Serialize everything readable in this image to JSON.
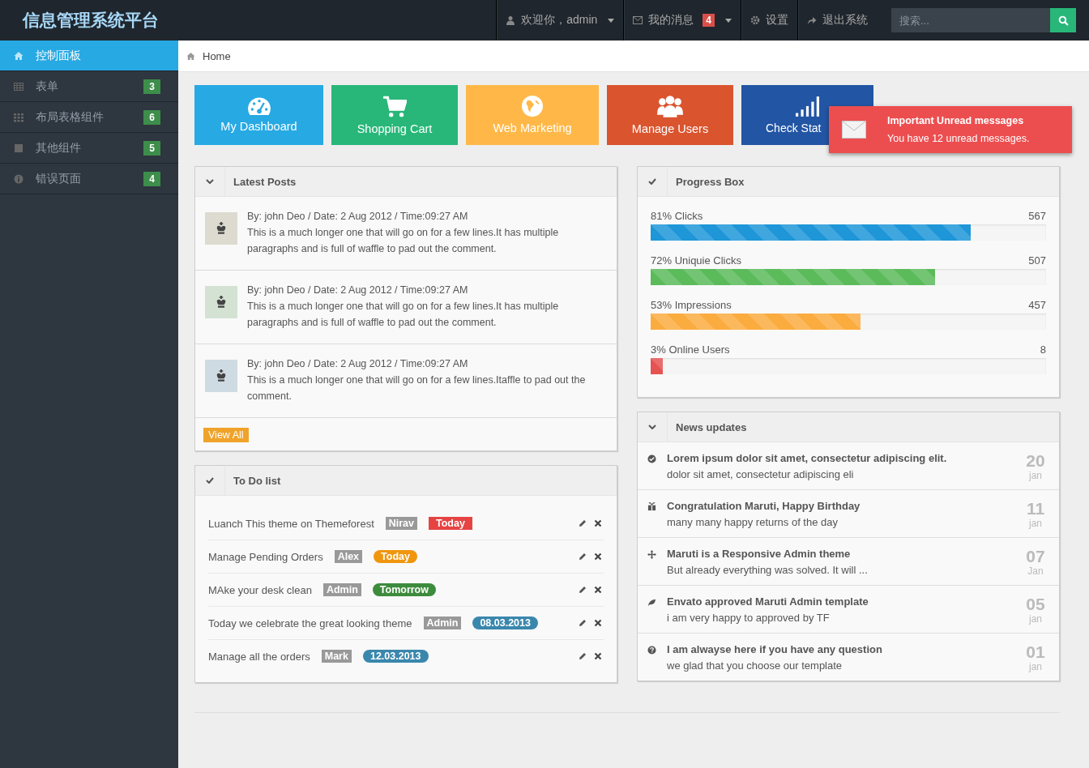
{
  "header": {
    "title": "信息管理系统平台",
    "user_menu": "欢迎你，admin",
    "messages": "我的消息",
    "messages_count": "4",
    "settings": "设置",
    "logout": "退出系统",
    "search": {
      "placeholder": "搜索..."
    }
  },
  "sidebar": {
    "items": [
      {
        "label": "控制面板",
        "kind": "home",
        "selected": true
      },
      {
        "label": "表单",
        "kind": "table",
        "badge": "3",
        "selected": false
      },
      {
        "label": "布局表格组件",
        "kind": "grid",
        "badge": "6",
        "selected": false
      },
      {
        "label": "其他组件",
        "kind": "square",
        "badge": "5",
        "selected": false
      },
      {
        "label": "错误页面",
        "kind": "info",
        "badge": "4",
        "selected": false
      }
    ]
  },
  "breadcrumb": "Home",
  "tiles": [
    {
      "label": "My Dashboard",
      "kind": "dashboard",
      "color": "#27a9e3"
    },
    {
      "label": "Shopping Cart",
      "kind": "cart",
      "color": "#28b779"
    },
    {
      "label": "Web Marketing",
      "kind": "globe",
      "color": "#ffb848"
    },
    {
      "label": "Manage Users",
      "kind": "users",
      "color": "#da542e"
    },
    {
      "label": "Check Stat",
      "kind": "signal",
      "color": "#2255a4"
    }
  ],
  "notification": {
    "title": "Important Unread messages",
    "text": "You have 12 unread messages."
  },
  "latest_posts": {
    "title": "Latest Posts",
    "posts": [
      {
        "meta": "By: john Deo / Date: 2 Aug 2012 / Time:09:27 AM",
        "text": "This is a much longer one that will go on for a few lines.It has multiple paragraphs and is full of waffle to pad out the comment.",
        "color": "#dddad0"
      },
      {
        "meta": "By: john Deo / Date: 2 Aug 2012 / Time:09:27 AM",
        "text": "This is a much longer one that will go on for a few lines.It has multiple paragraphs and is full of waffle to pad out the comment.",
        "color": "#d3e2d3"
      },
      {
        "meta": "By: john Deo / Date: 2 Aug 2012 / Time:09:27 AM",
        "text": "This is a much longer one that will go on for a few lines.Itaffle to pad out the comment.",
        "color": "#cfdbe2"
      }
    ],
    "button": "View All"
  },
  "todo": {
    "title": "To Do list",
    "items": [
      {
        "text": "Luanch This theme on Themeforest",
        "person": "Nirav",
        "tag": "Today",
        "kind": "rect",
        "color": "#e64343"
      },
      {
        "text": "Manage Pending Orders",
        "person": "Alex",
        "tag": "Today",
        "kind": "pill",
        "color": "#f0960e"
      },
      {
        "text": "MAke your desk clean",
        "person": "Admin",
        "tag": "Tomorrow",
        "kind": "pill",
        "color": "#3d8b3d"
      },
      {
        "text": "Today we celebrate the great looking theme",
        "person": "Admin",
        "tag": "08.03.2013",
        "kind": "pill",
        "color": "#3a87ad"
      },
      {
        "text": "Manage all the orders",
        "person": "Mark",
        "tag": "12.03.2013",
        "kind": "pill",
        "color": "#3a87ad"
      }
    ]
  },
  "progress_box": {
    "title": "Progress Box",
    "bars": [
      {
        "label": "81% Clicks",
        "value": "567",
        "level": 0.81,
        "color": "#1e96d8"
      },
      {
        "label": "72% Uniquie Clicks",
        "value": "507",
        "level": 0.72,
        "color": "#5bbb5b"
      },
      {
        "label": "53% Impressions",
        "value": "457",
        "level": 0.53,
        "color": "#fbac3f"
      },
      {
        "label": "3% Online Users",
        "value": "8",
        "level": 0.03,
        "color": "#e65353"
      }
    ]
  },
  "news": {
    "title": "News updates",
    "items": [
      {
        "kind": "check",
        "title": "Lorem ipsum dolor sit amet, consectetur adipiscing elit.",
        "text": "dolor sit amet, consectetur adipiscing eli",
        "day": "20",
        "month": "jan"
      },
      {
        "kind": "gift",
        "title": "Congratulation Maruti, Happy Birthday",
        "text": "many many happy returns of the day",
        "day": "11",
        "month": "jan"
      },
      {
        "kind": "move",
        "title": "Maruti is a Responsive Admin theme",
        "text": "But already everything was solved. It will ...",
        "day": "07",
        "month": "Jan"
      },
      {
        "kind": "leaf",
        "title": "Envato approved Maruti Admin template",
        "text": "i am very happy to approved by TF",
        "day": "05",
        "month": "jan"
      },
      {
        "kind": "question",
        "title": "I am alwayse here if you have any question",
        "text": "we glad that you choose our template",
        "day": "01",
        "month": "jan"
      }
    ]
  }
}
